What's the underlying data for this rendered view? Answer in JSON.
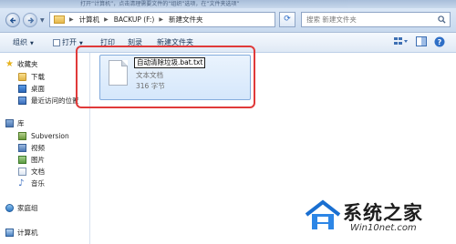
{
  "caption_strip": "打开“计算机”，点击清理需要文件的“组织”选项，在“文件夹选项”",
  "address_bar": {
    "crumbs": [
      "计算机",
      "BACKUP (F:)",
      "新建文件夹"
    ],
    "search_placeholder": "搜索 新建文件夹"
  },
  "toolbar": {
    "organize": "组织",
    "open": "打开",
    "print": "打印",
    "burn": "刻录",
    "new_folder": "新建文件夹"
  },
  "sidebar": {
    "favorites": "收藏夹",
    "downloads": "下载",
    "desktop": "桌面",
    "recent": "最近访问的位置",
    "libraries": "库",
    "subversion": "Subversion",
    "videos": "视频",
    "pictures": "图片",
    "documents": "文档",
    "music": "音乐",
    "homegroup": "家庭组",
    "computer": "计算机"
  },
  "file": {
    "name": "自动清除垃圾.bat.txt",
    "type": "文本文档",
    "size": "316 字节"
  },
  "watermark": {
    "brand": "系统之家",
    "url": "Win10net.com"
  },
  "colors": {
    "highlight": "#e03a3a",
    "accent": "#2c6bc7"
  }
}
